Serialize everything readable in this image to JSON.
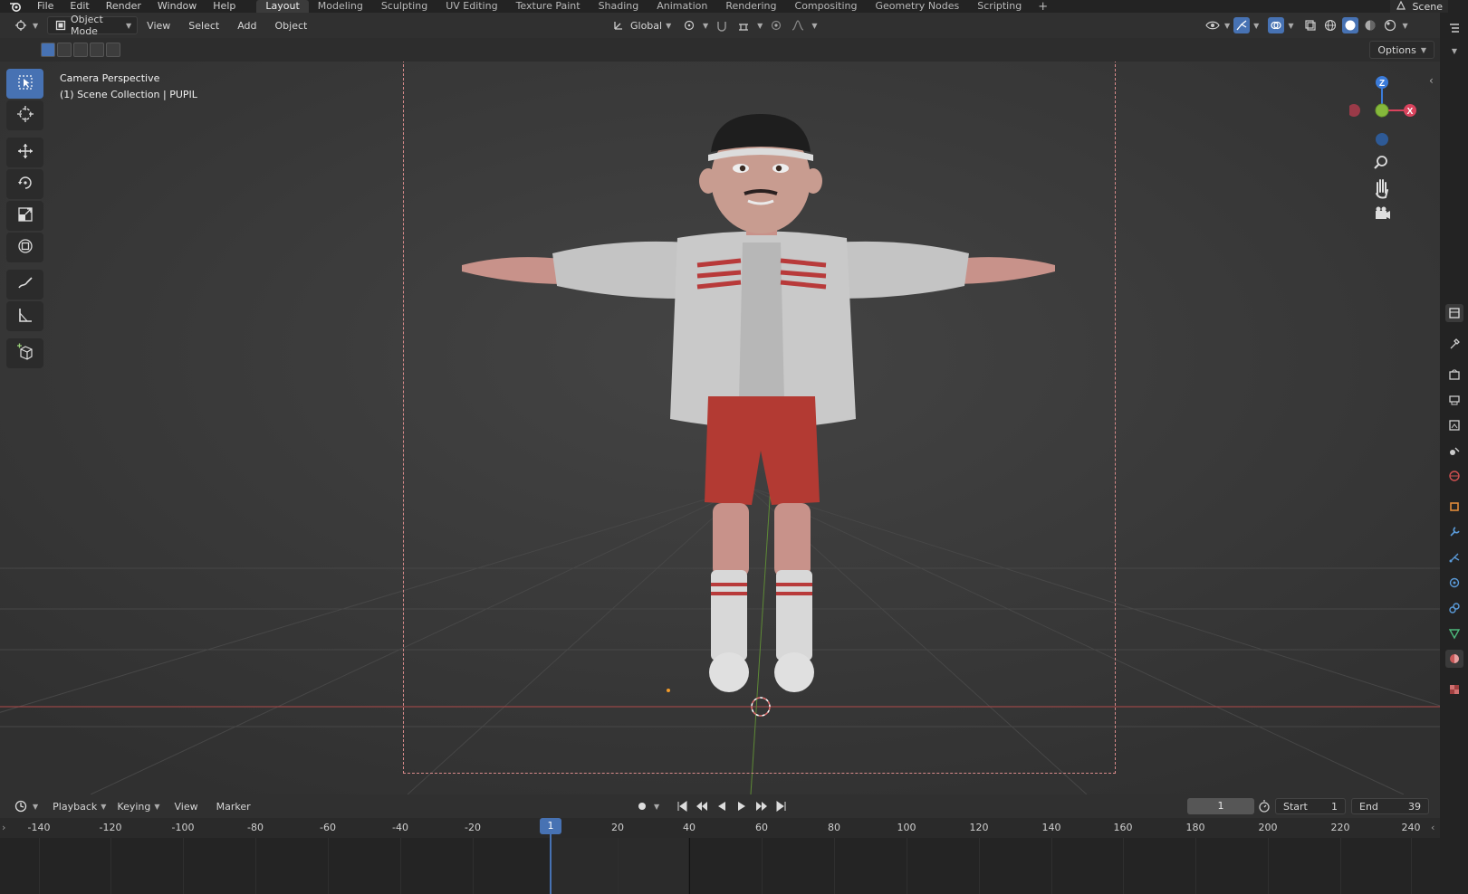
{
  "topbar": {
    "menus": [
      "File",
      "Edit",
      "Render",
      "Window",
      "Help"
    ],
    "workspaces": [
      "Layout",
      "Modeling",
      "Sculpting",
      "UV Editing",
      "Texture Paint",
      "Shading",
      "Animation",
      "Rendering",
      "Compositing",
      "Geometry Nodes",
      "Scripting"
    ],
    "active_workspace": "Layout",
    "scene_label": "Scene"
  },
  "viewport_header": {
    "mode": "Object Mode",
    "menus": [
      "View",
      "Select",
      "Add",
      "Object"
    ],
    "orientation": "Global",
    "options_label": "Options"
  },
  "viewport": {
    "perspective_label": "Camera Perspective",
    "collection_label": "(1) Scene Collection | PUPIL",
    "background_color": "#3d3d3d"
  },
  "tools": [
    "select-box-icon",
    "cursor-icon",
    "move-icon",
    "rotate-icon",
    "scale-icon",
    "transform-icon",
    "annotate-icon",
    "measure-icon",
    "add-cube-icon"
  ],
  "gizmo": {
    "z": "Z",
    "x": "X"
  },
  "timeline": {
    "menus": [
      "Playback",
      "Keying",
      "View",
      "Marker"
    ],
    "current_frame": "1",
    "start_label": "Start",
    "start_value": "1",
    "end_label": "End",
    "end_value": "39",
    "ticks": [
      "-140",
      "-120",
      "-100",
      "-80",
      "-60",
      "-40",
      "-20",
      "20",
      "40",
      "60",
      "80",
      "100",
      "120",
      "140",
      "160",
      "180",
      "200",
      "220",
      "240"
    ]
  },
  "colors": {
    "accent": "#4772b3",
    "x_axis": "#d9435d",
    "y_axis": "#85b83b",
    "z_axis": "#3b7bd9"
  }
}
